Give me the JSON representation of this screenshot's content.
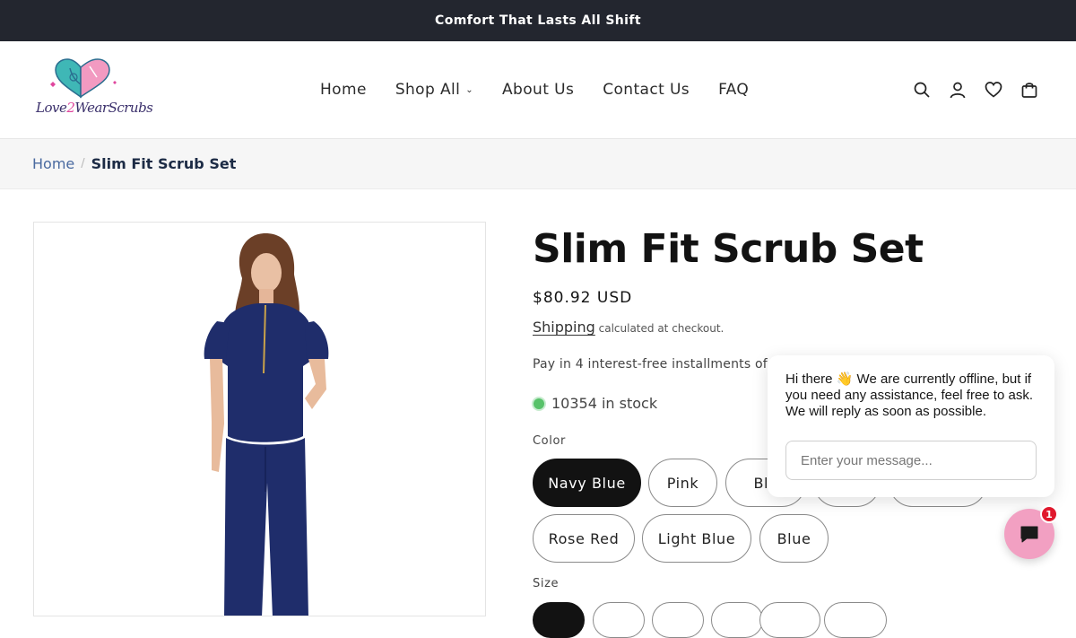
{
  "announcement": "Comfort That Lasts All Shift",
  "brand": {
    "name_part1": "Love",
    "name_part2": "2",
    "name_part3": "WearScrubs"
  },
  "nav": {
    "items": [
      "Home",
      "Shop All",
      "About Us",
      "Contact Us",
      "FAQ"
    ],
    "dropdown_icon": "chevron-down-icon"
  },
  "header_icons": [
    "search-icon",
    "account-icon",
    "heart-icon",
    "cart-icon"
  ],
  "breadcrumb": {
    "home": "Home",
    "separator": "/",
    "current": "Slim Fit Scrub Set"
  },
  "product": {
    "title": "Slim Fit Scrub Set",
    "price": "$80.92 USD",
    "shipping_link": "Shipping",
    "shipping_note": "calculated at checkout.",
    "installments": "Pay in 4 interest-free installments of $20",
    "stock": "10354 in stock",
    "color_label": "Color",
    "colors": [
      "Navy Blue",
      "Pink",
      "Bla",
      "",
      "",
      "Rose Red",
      "Light Blue",
      "Blue"
    ],
    "selected_color": "Navy Blue",
    "size_label": "Size"
  },
  "chat": {
    "greeting_before": "Hi there ",
    "wave_emoji": "👋",
    "greeting_after": " We are currently offline, but if you need any assistance, feel free to ask. We will reply as soon as possible.",
    "input_placeholder": "Enter your message...",
    "badge_count": "1"
  },
  "colors": {
    "announcement_bg": "#23262f",
    "chat_button": "#f2a0c2",
    "badge": "#e0182d",
    "stock_dot": "#58c26a",
    "selected_pill": "#121212",
    "scrub_navy": "#1f2d6b"
  }
}
